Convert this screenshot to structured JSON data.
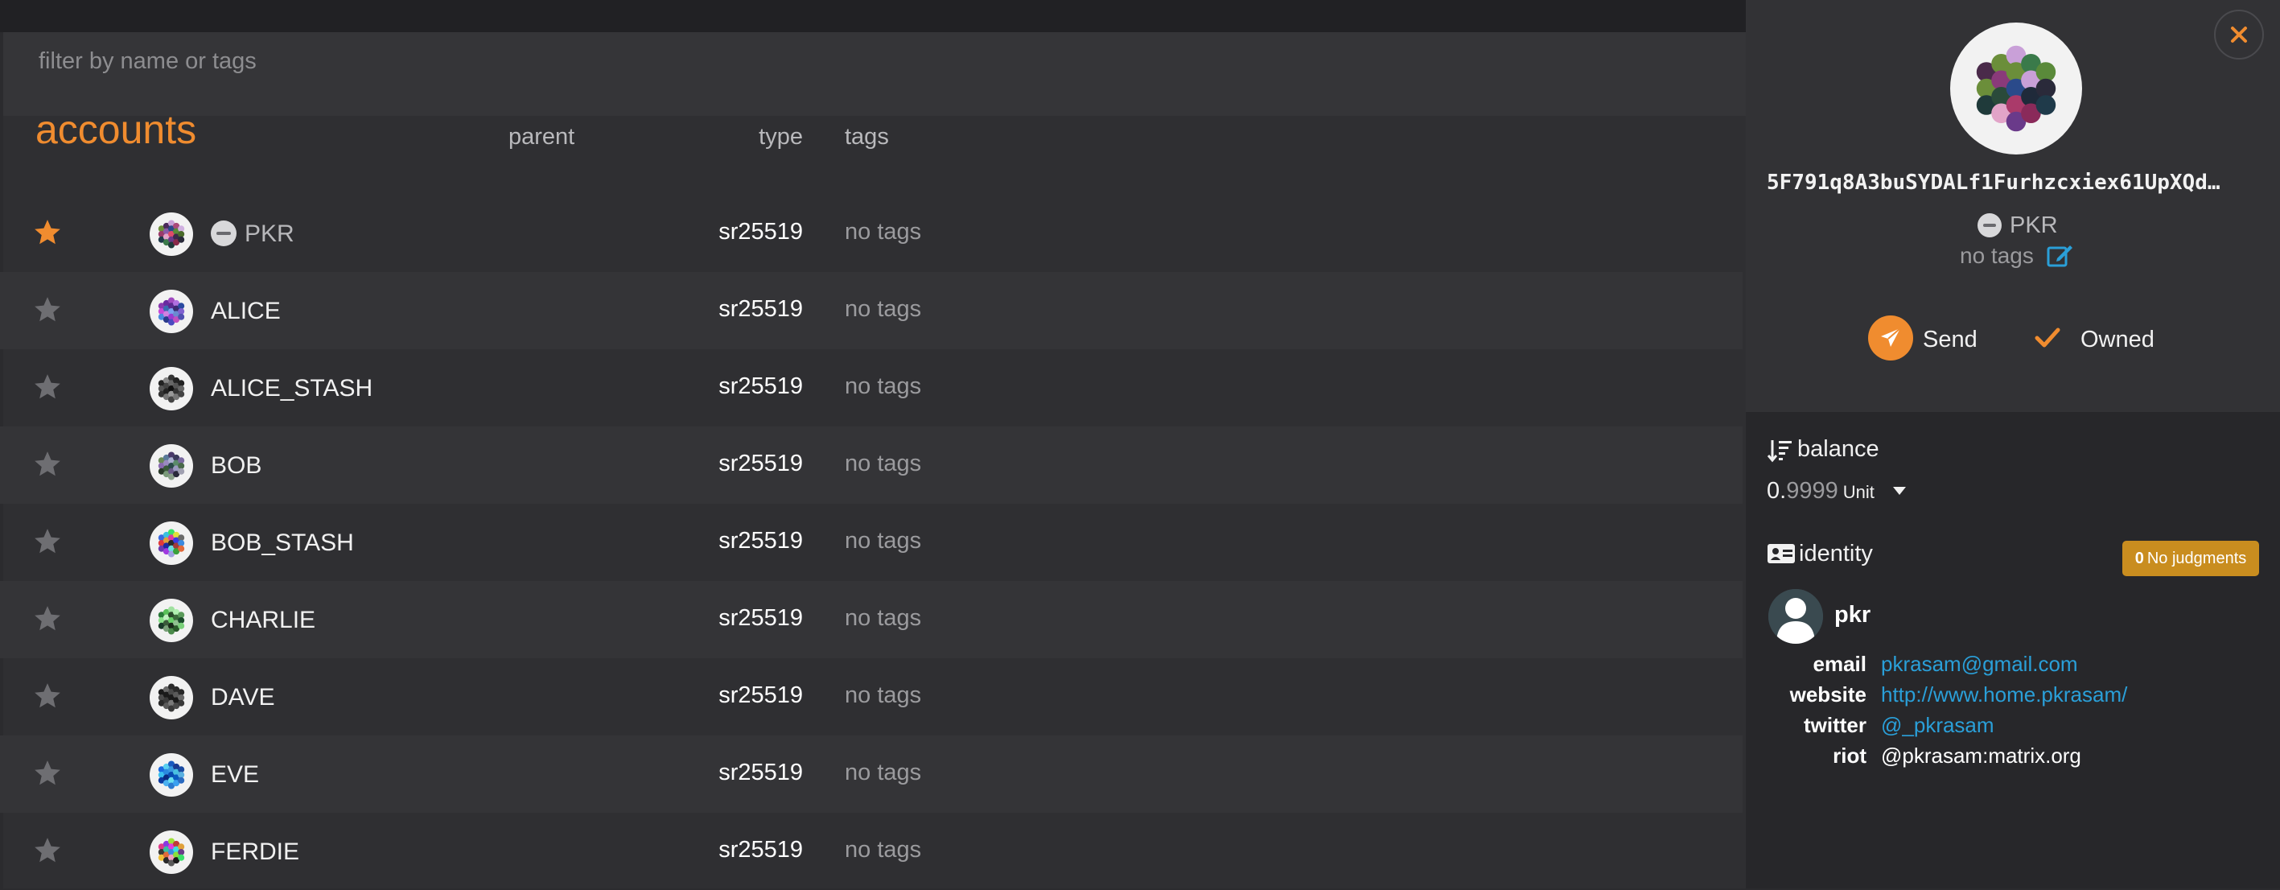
{
  "filter": {
    "placeholder": "filter by name or tags"
  },
  "header": {
    "title": "accounts",
    "col_parent": "parent",
    "col_type": "type",
    "col_tags": "tags"
  },
  "accounts": [
    {
      "name": "PKR",
      "type": "sr25519",
      "tags": "no tags",
      "favorite": true,
      "injected": true,
      "palette": [
        "#6b8e3a",
        "#9b3a6a",
        "#1f3a4a",
        "#4a2a5a",
        "#8a5aa8",
        "#e2a4c8",
        "#3a7a4a",
        "#c9a0d8",
        "#2a4a8a",
        "#e04a6a",
        "#6a3a8a",
        "#1f3a3a",
        "#aa4a7a",
        "#5a8a3a",
        "#3a2a4a",
        "#8a2a4a",
        "#d0b0e0",
        "#4a6a2a",
        "#2a2a3a"
      ]
    },
    {
      "name": "ALICE",
      "type": "sr25519",
      "tags": "no tags",
      "favorite": false,
      "injected": false,
      "palette": [
        "#8a3ab0",
        "#c84ad8",
        "#4a8ae0",
        "#6a2aa0",
        "#3a6ab0",
        "#d080e0",
        "#2a3a8a",
        "#a04ac0",
        "#5a2a90",
        "#7aa0f0",
        "#9a3ad0",
        "#4a4ac0",
        "#b070e0",
        "#3a2a70",
        "#6a8ad0",
        "#c050c0",
        "#2a4aa0",
        "#8060d0",
        "#5050b0"
      ]
    },
    {
      "name": "ALICE_STASH",
      "type": "sr25519",
      "tags": "no tags",
      "favorite": false,
      "injected": false,
      "palette": [
        "#222222",
        "#555555",
        "#333333",
        "#888888",
        "#444444",
        "#222222",
        "#777777",
        "#333333",
        "#666666",
        "#111111",
        "#999999",
        "#444444",
        "#222222",
        "#555555",
        "#333333",
        "#777777",
        "#222222",
        "#666666",
        "#444444"
      ]
    },
    {
      "name": "BOB",
      "type": "sr25519",
      "tags": "no tags",
      "favorite": false,
      "injected": false,
      "palette": [
        "#6a8a5a",
        "#8a6ab0",
        "#2a3a2a",
        "#5a7a9a",
        "#9a8ac0",
        "#3a5a3a",
        "#7a9a7a",
        "#4a3a6a",
        "#aab0d0",
        "#2a4a4a",
        "#6a5a8a",
        "#8aa08a",
        "#3a3a5a",
        "#5a8a6a",
        "#9a9ac0",
        "#2a2a3a",
        "#7a6aa0",
        "#4a6a4a",
        "#a0a0b0"
      ]
    },
    {
      "name": "BOB_STASH",
      "type": "sr25519",
      "tags": "no tags",
      "favorite": false,
      "injected": false,
      "palette": [
        "#3a6ae0",
        "#e03a3a",
        "#6a3ab0",
        "#3ac0e0",
        "#e0a03a",
        "#1a2aa0",
        "#a03ae0",
        "#3ae06a",
        "#e03aa0",
        "#2a2a2a",
        "#6ae0e0",
        "#a0a0e0",
        "#e0e03a",
        "#3a3ae0",
        "#a03a3a",
        "#3aa03a",
        "#6a6a6a",
        "#3a8ae0",
        "#e06a3a"
      ]
    },
    {
      "name": "CHARLIE",
      "type": "sr25519",
      "tags": "no tags",
      "favorite": false,
      "injected": false,
      "palette": [
        "#2a7a3a",
        "#8ae08a",
        "#1a3a2a",
        "#5ac05a",
        "#c0f0c0",
        "#3a5a3a",
        "#7aa07a",
        "#a0e0a0",
        "#2a4a2a",
        "#6ad06a",
        "#1a2a1a",
        "#4a8a4a",
        "#b0f0b0",
        "#3a6a3a",
        "#90c090",
        "#2a5a2a",
        "#5a9a5a",
        "#1a4a2a",
        "#7ad07a"
      ]
    },
    {
      "name": "DAVE",
      "type": "sr25519",
      "tags": "no tags",
      "favorite": false,
      "injected": false,
      "palette": [
        "#1a1a1a",
        "#4a4a4a",
        "#2a2a2a",
        "#6a6a6a",
        "#1a1a1a",
        "#3a3a3a",
        "#5a5a5a",
        "#2a2a2a",
        "#4a4a4a",
        "#1a1a1a",
        "#7a7a7a",
        "#3a3a3a",
        "#2a2a2a",
        "#5a5a5a",
        "#1a1a1a",
        "#4a4a4a",
        "#2a2a2a",
        "#6a6a6a",
        "#3a3a3a"
      ]
    },
    {
      "name": "EVE",
      "type": "sr25519",
      "tags": "no tags",
      "favorite": false,
      "injected": false,
      "palette": [
        "#1a6ae0",
        "#3ac0f0",
        "#0a3aa0",
        "#5ad0f0",
        "#2a8ae0",
        "#0a2a80",
        "#4ab0f0",
        "#1a5ac0",
        "#3a9ae0",
        "#0a4ab0",
        "#6ae0f0",
        "#2a7ad0",
        "#1a3a90",
        "#4ac0e0",
        "#0a5ac0",
        "#3aa0f0",
        "#1a4aa0",
        "#5ab0e0",
        "#2a6ac0"
      ]
    },
    {
      "name": "FERDIE",
      "type": "sr25519",
      "tags": "no tags",
      "favorite": false,
      "injected": false,
      "palette": [
        "#e03a8a",
        "#3a3a3a",
        "#f0c03a",
        "#8a3ae0",
        "#3ac0a0",
        "#e06a3a",
        "#2a2a2a",
        "#a0e03a",
        "#e03ae0",
        "#3a8ae0",
        "#f0a0c0",
        "#5a5a5a",
        "#c03a3a",
        "#3ae0e0",
        "#8ae03a",
        "#1a1a1a",
        "#e0a03a",
        "#6a3a8a",
        "#3ae06a"
      ]
    }
  ],
  "panel": {
    "address": "5F791q8A3buSYDALf1Furhzcxiex61UpXQd…",
    "name": "PKR",
    "tags": "no tags",
    "send_label": "Send",
    "owned_label": "Owned",
    "balance": {
      "label": "balance",
      "integer": "0.",
      "fraction": "9999",
      "unit": "Unit"
    },
    "identity": {
      "label": "identity",
      "judgments_count": "0",
      "judgments_label": "No judgments",
      "display": "pkr",
      "fields": [
        {
          "label": "email",
          "value": "pkrasam@gmail.com",
          "link": true
        },
        {
          "label": "website",
          "value": "http://www.home.pkrasam/",
          "link": true
        },
        {
          "label": "twitter",
          "value": "@_pkrasam",
          "link": true
        },
        {
          "label": "riot",
          "value": "@pkrasam:matrix.org",
          "link": false
        }
      ]
    },
    "avatar_palette": [
      "#4a2a4a",
      "#6b8e3a",
      "#1f3a3a",
      "#6b8e3a",
      "#8a3a7a",
      "#2a4a3a",
      "#e2a4c8",
      "#c9a0d8",
      "#6b8e3a",
      "#2a4a8a",
      "#aa3a6a",
      "#6a3a8a",
      "#3a7a4a",
      "#c9a0d8",
      "#1f2a3a",
      "#8a2a5a",
      "#5a8a3a",
      "#2a2a3a",
      "#1f3a4a"
    ]
  },
  "colors": {
    "accent": "#f08c2f",
    "link": "#2a9fd8",
    "judgment_badge": "#c98d1f"
  }
}
